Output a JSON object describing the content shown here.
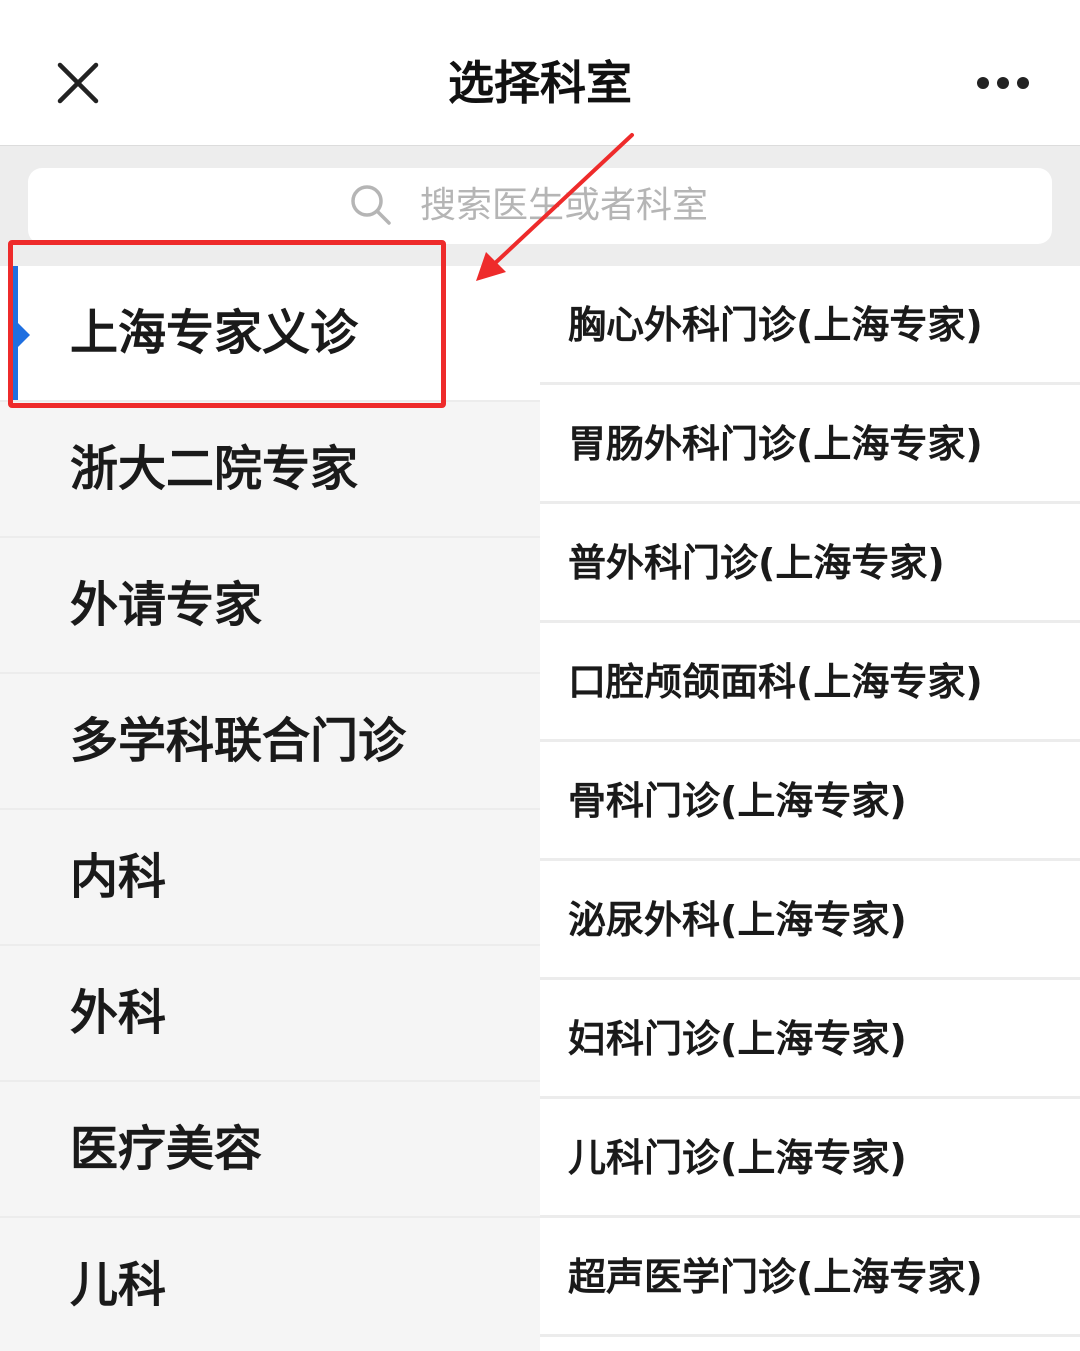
{
  "header": {
    "title": "选择科室",
    "close_icon": "close-icon",
    "more_icon": "more-dots-icon"
  },
  "search": {
    "placeholder": "搜索医生或者科室",
    "icon": "search-icon"
  },
  "categories": [
    {
      "label": "上海专家义诊",
      "active": true
    },
    {
      "label": "浙大二院专家"
    },
    {
      "label": "外请专家"
    },
    {
      "label": "多学科联合门诊"
    },
    {
      "label": "内科"
    },
    {
      "label": "外科"
    },
    {
      "label": "医疗美容"
    },
    {
      "label": "儿科"
    }
  ],
  "departments": [
    {
      "label": "胸心外科门诊(上海专家)"
    },
    {
      "label": "胃肠外科门诊(上海专家)"
    },
    {
      "label": "普外科门诊(上海专家)"
    },
    {
      "label": "口腔颅颌面科(上海专家)"
    },
    {
      "label": "骨科门诊(上海专家)"
    },
    {
      "label": "泌尿外科(上海专家)"
    },
    {
      "label": "妇科门诊(上海专家)"
    },
    {
      "label": "儿科门诊(上海专家)"
    },
    {
      "label": "超声医学门诊(上海专家)"
    }
  ],
  "colors": {
    "accent": "#1f6fe0",
    "annotation": "#ee2b2b",
    "left_panel_bg": "#f5f5f5",
    "search_area_bg": "#ededed",
    "placeholder_text": "#b5b5b5"
  }
}
